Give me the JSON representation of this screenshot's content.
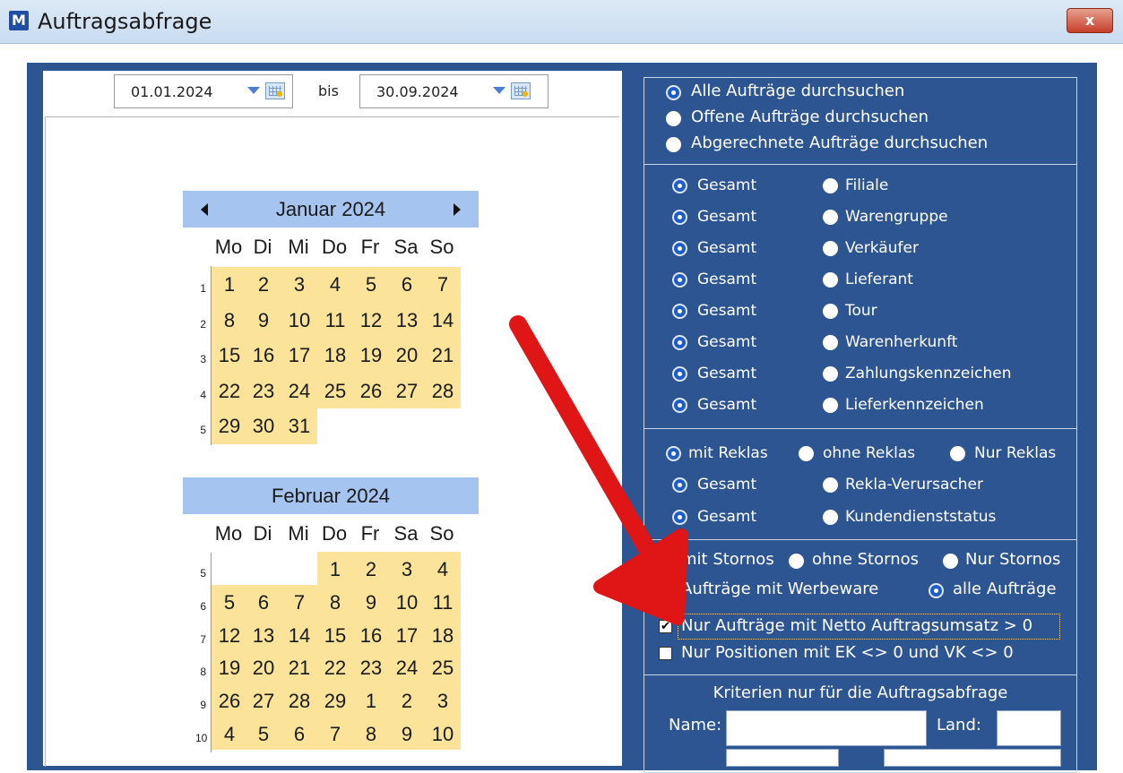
{
  "window": {
    "title": "Auftragsabfrage",
    "icon_letter": "M",
    "close_label": "x"
  },
  "date_range": {
    "from": "01.01.2024",
    "separator": "bis",
    "to": "30.09.2024"
  },
  "calendar": {
    "weekdays": [
      "Mo",
      "Di",
      "Mi",
      "Do",
      "Fr",
      "Sa",
      "So"
    ],
    "months": [
      {
        "title": "Januar 2024",
        "weeks": [
          {
            "wk": "1",
            "days": [
              "1",
              "2",
              "3",
              "4",
              "5",
              "6",
              "7"
            ]
          },
          {
            "wk": "2",
            "days": [
              "8",
              "9",
              "10",
              "11",
              "12",
              "13",
              "14"
            ]
          },
          {
            "wk": "3",
            "days": [
              "15",
              "16",
              "17",
              "18",
              "19",
              "20",
              "21"
            ]
          },
          {
            "wk": "4",
            "days": [
              "22",
              "23",
              "24",
              "25",
              "26",
              "27",
              "28"
            ]
          },
          {
            "wk": "5",
            "days": [
              "29",
              "30",
              "31",
              "",
              "",
              "",
              ""
            ]
          }
        ]
      },
      {
        "title": "Februar 2024",
        "weeks": [
          {
            "wk": "5",
            "days": [
              "",
              "",
              "",
              "1",
              "2",
              "3",
              "4"
            ]
          },
          {
            "wk": "6",
            "days": [
              "5",
              "6",
              "7",
              "8",
              "9",
              "10",
              "11"
            ]
          },
          {
            "wk": "7",
            "days": [
              "12",
              "13",
              "14",
              "15",
              "16",
              "17",
              "18"
            ]
          },
          {
            "wk": "8",
            "days": [
              "19",
              "20",
              "21",
              "22",
              "23",
              "24",
              "25"
            ]
          },
          {
            "wk": "9",
            "days": [
              "26",
              "27",
              "28",
              "29",
              "1",
              "2",
              "3"
            ]
          },
          {
            "wk": "10",
            "days": [
              "4",
              "5",
              "6",
              "7",
              "8",
              "9",
              "10"
            ]
          }
        ]
      }
    ]
  },
  "search_scope": {
    "options": [
      "Alle Aufträge durchsuchen",
      "Offene Aufträge durchsuchen",
      "Abgerechnete Aufträge durchsuchen"
    ],
    "selected_index": 0
  },
  "filters": {
    "gesamt_label": "Gesamt",
    "rows": [
      "Filiale",
      "Warengruppe",
      "Verkäufer",
      "Lieferant",
      "Tour",
      "Warenherkunft",
      "Zahlungskennzeichen",
      "Lieferkennzeichen"
    ]
  },
  "reklas": {
    "options": [
      "mit Reklas",
      "ohne Reklas",
      "Nur Reklas"
    ],
    "selected_index": 0,
    "rows": [
      "Rekla-Verursacher",
      "Kundendienststatus"
    ]
  },
  "stornos": {
    "options": [
      "mit Stornos",
      "ohne Stornos",
      "Nur Stornos"
    ],
    "selected_index": 0,
    "werbeware": [
      "Aufträge mit Werbeware",
      "alle Aufträge"
    ],
    "werbeware_selected_index": 1
  },
  "checkboxes": [
    {
      "label": "Nur Aufträge mit Netto Auftragsumsatz > 0",
      "checked": true
    },
    {
      "label": "Nur Positionen mit EK <> 0 und VK <> 0",
      "checked": false
    }
  ],
  "criteria": {
    "title": "Kriterien nur für die Auftragsabfrage",
    "name_label": "Name:",
    "land_label": "Land:",
    "name_value": "",
    "land_value": ""
  },
  "colors": {
    "panel": "#2d5591",
    "calendar_day": "#fbe39a",
    "calendar_header": "#a6c4f0",
    "annotation_arrow": "#e01616"
  }
}
